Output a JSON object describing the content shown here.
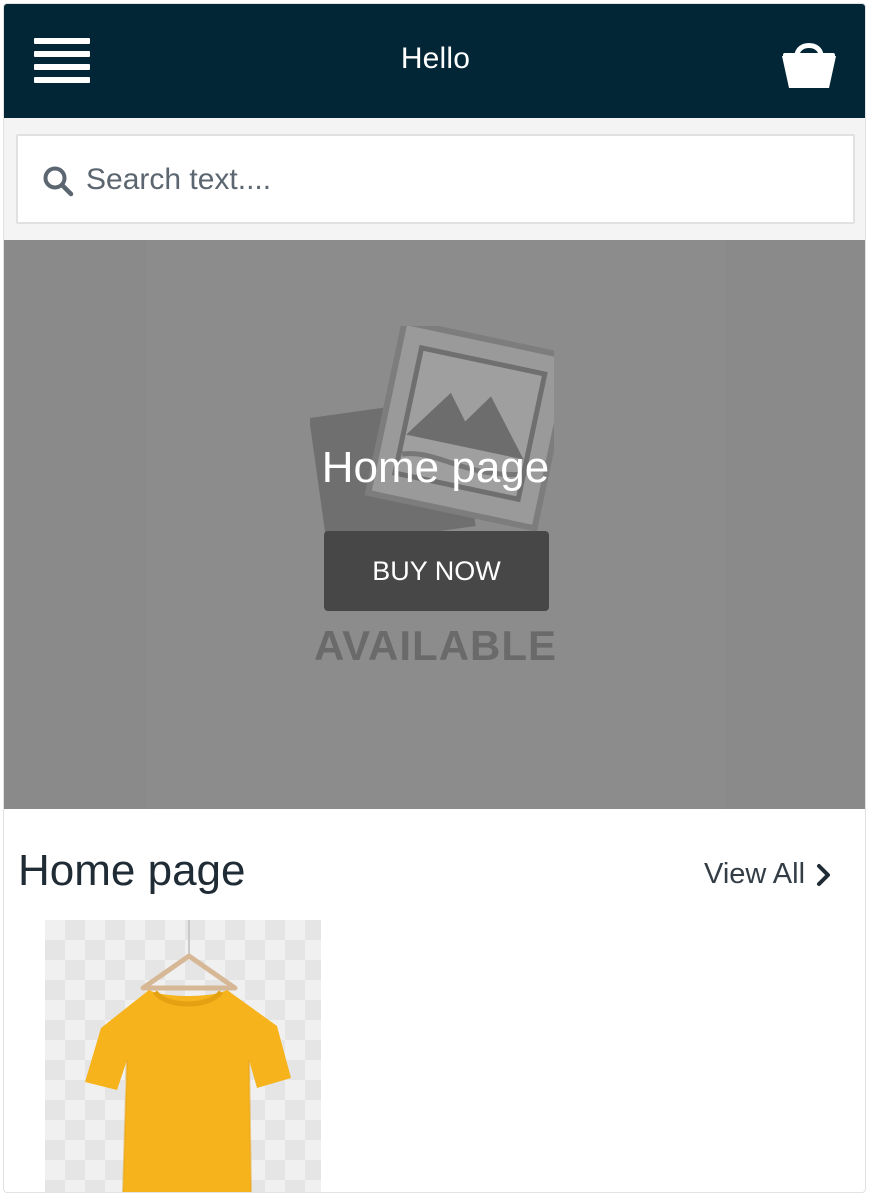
{
  "header": {
    "title": "Hello",
    "menu_icon": "hamburger-menu-icon",
    "cart_icon": "shopping-basket-icon",
    "background_color": "#022636"
  },
  "search": {
    "placeholder": "Search text....",
    "icon": "search-icon"
  },
  "hero": {
    "title": "Home page",
    "button_label": "BUY NOW",
    "placeholder_text": "AVAILABLE",
    "placeholder_icon": "no-image-placeholder-icon"
  },
  "section": {
    "title": "Home page",
    "view_all_label": "View All",
    "view_all_icon": "chevron-right-icon"
  },
  "products": [
    {
      "image": "yellow-tshirt-on-hanger"
    }
  ]
}
